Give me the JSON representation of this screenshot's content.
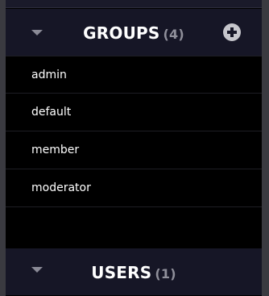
{
  "groups": {
    "title": "GROUPS",
    "count": "(4)",
    "add_icon": "plus-circle-icon",
    "collapse_icon": "caret-down-icon",
    "items": [
      {
        "label": "admin"
      },
      {
        "label": "default"
      },
      {
        "label": "member"
      },
      {
        "label": "moderator"
      }
    ]
  },
  "users": {
    "title": "USERS",
    "count": "(1)",
    "collapse_icon": "caret-down-icon"
  }
}
